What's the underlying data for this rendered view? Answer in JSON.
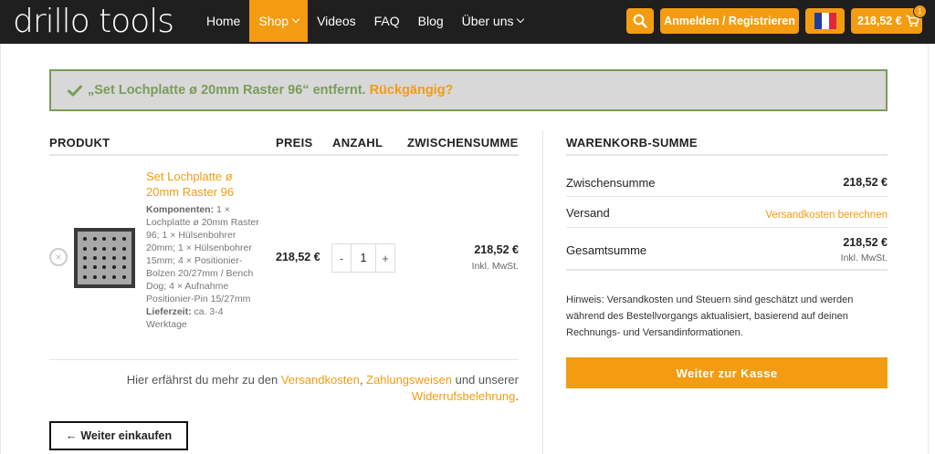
{
  "header": {
    "logo": "drillo tools",
    "nav": [
      {
        "label": "Home"
      },
      {
        "label": "Shop"
      },
      {
        "label": "Videos"
      },
      {
        "label": "FAQ"
      },
      {
        "label": "Blog"
      },
      {
        "label": "Über uns"
      }
    ],
    "login_label": "Anmelden / Registrieren",
    "cart_total": "218,52 €",
    "cart_count": "1",
    "accent_color": "#f39c12"
  },
  "notice": {
    "message": "„Set Lochplatte ø 20mm Raster 96“ entfernt.",
    "undo_label": "Rückgängig?"
  },
  "cart": {
    "headers": {
      "product": "PRODUKT",
      "price": "PREIS",
      "quantity": "ANZAHL",
      "subtotal": "ZWISCHENSUMME"
    },
    "item": {
      "name": "Set Lochplatte ø 20mm Raster 96",
      "components_label": "Komponenten:",
      "components_text": " 1 × Lochplatte ø 20mm Raster 96; 1 × Hülsenbohrer 20mm; 1 × Hülsenbohrer 15mm; 4 × Positionier-Bolzen 20/27mm / Bench Dog; 4 × Aufnahme Positionier-Pin 15/27mm",
      "delivery_label": "Lieferzeit:",
      "delivery_text": " ca. 3-4 Werktage",
      "price": "218,52 €",
      "quantity": "1",
      "subtotal": "218,52 €",
      "tax_note": "Inkl. MwSt."
    },
    "info_pre": "Hier erfährst du mehr zu den ",
    "info_link1": "Versandkosten",
    "info_sep": ", ",
    "info_link2": "Zahlungsweisen",
    "info_mid": " und unserer ",
    "info_link3": "Widerrufsbelehrung",
    "info_end": ".",
    "continue_label": "Weiter einkaufen"
  },
  "totals": {
    "title": "WARENKORB-SUMME",
    "subtotal_label": "Zwischensumme",
    "subtotal_value": "218,52 €",
    "shipping_label": "Versand",
    "shipping_value": "Versandkosten berechnen",
    "total_label": "Gesamtsumme",
    "total_value": "218,52 €",
    "total_tax_note": "Inkl. MwSt.",
    "hint": "Hinweis: Versandkosten und Steuern sind geschätzt und werden während des Bestellvorgangs aktualisiert, basierend auf deinen Rechnungs- und Versandinformationen.",
    "checkout_label": "Weiter zur Kasse"
  }
}
